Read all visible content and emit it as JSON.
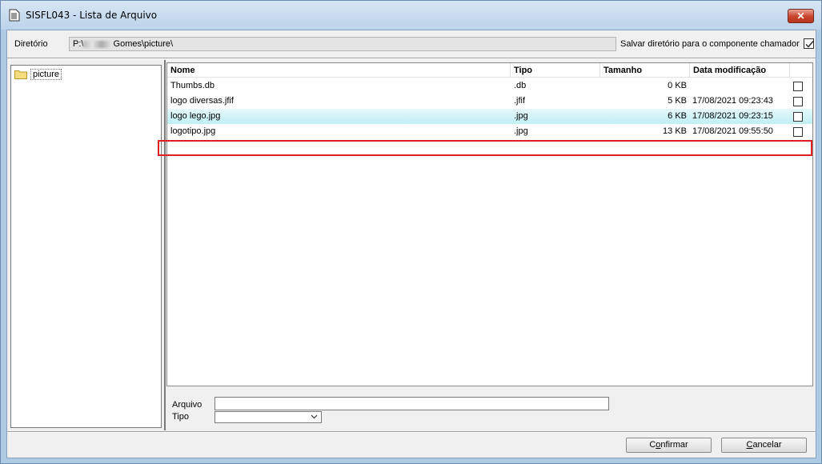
{
  "window": {
    "title": "SISFL043 - Lista de Arquivo",
    "close_label": "✕"
  },
  "directory": {
    "label": "Diretório",
    "path_prefix": "P:\\",
    "path_suffix": "Gomes\\picture\\",
    "save_label": "Salvar diretório para o componente chamador",
    "save_checked": true
  },
  "tree": {
    "items": [
      {
        "label": "picture",
        "icon": "folder-icon"
      }
    ]
  },
  "list": {
    "columns": [
      "Nome",
      "Tipo",
      "Tamanho",
      "Data modificação"
    ],
    "rows": [
      {
        "name": "Thumbs.db",
        "type": ".db",
        "size": "0 KB",
        "date": ""
      },
      {
        "name": "logo diversas.jfif",
        "type": ".jfif",
        "size": "5 KB",
        "date": "17/08/2021 09:23:43"
      },
      {
        "name": "logo lego.jpg",
        "type": ".jpg",
        "size": "6 KB",
        "date": "17/08/2021 09:23:15"
      },
      {
        "name": "logotipo.jpg",
        "type": ".jpg",
        "size": "13 KB",
        "date": "17/08/2021 09:55:50"
      }
    ],
    "selected_index": 2
  },
  "form": {
    "arquivo_label": "Arquivo",
    "arquivo_value": "",
    "tipo_label": "Tipo",
    "tipo_value": ""
  },
  "buttons": {
    "confirm_pre": "C",
    "confirm_u": "o",
    "confirm_post": "nfirmar",
    "cancel_pre": "",
    "cancel_u": "C",
    "cancel_post": "ancelar"
  },
  "colors": {
    "selection_highlight": "#e02020",
    "window_frame": "#aecbe6",
    "close_button": "#c7432b"
  }
}
